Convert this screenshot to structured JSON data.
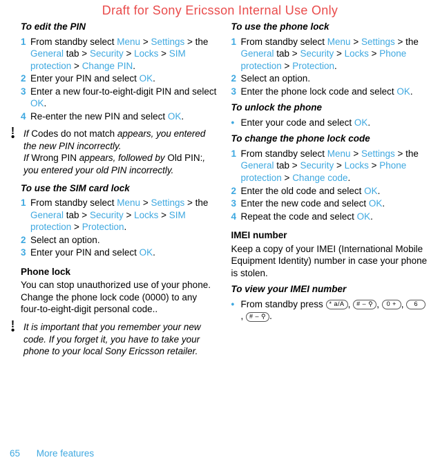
{
  "watermark": "Draft for Sony Ericsson Internal Use Only",
  "left": {
    "h_edit_pin": "To edit the PIN",
    "edit_pin_s1_a": "From standby select ",
    "menu": "Menu",
    "settings": "Settings",
    "the": " the ",
    "general": "General",
    "tab": " tab > ",
    "security": "Security",
    "locks": "Locks",
    "sim_protection": "SIM protection",
    "change_pin": "Change PIN",
    "edit_pin_s2_a": "Enter your PIN and select ",
    "ok": "OK",
    "edit_pin_s3": "Enter a new four-to-eight-digit PIN and select ",
    "edit_pin_s4": "Re-enter the new PIN and select ",
    "note1_a": "If ",
    "note1_b": "Codes do not match",
    "note1_c": " appears, you entered the new PIN incorrectly.",
    "note1_d": "If ",
    "note1_e": "Wrong PIN",
    "note1_f": " appears, followed by ",
    "note1_g": "Old PIN:",
    "note1_h": ", you entered your old PIN incorrectly.",
    "h_sim_lock": "To use the SIM card lock",
    "sim_s1_a": "From standby select ",
    "the_word": "the ",
    "protection": "Protection",
    "sim_s2": "Select an option.",
    "sim_s3": "Enter your PIN and select ",
    "h_phone_lock": "Phone lock",
    "phone_lock_para": "You can stop unauthorized use of your phone. Change the phone lock code (0000) to any four-to-eight-digit personal code..",
    "note2": "It is important that you remember your new code. If you forget it, you have to take your phone to your local Sony Ericsson retailer."
  },
  "right": {
    "h_use_phone_lock": "To use the phone lock",
    "upl_s1_a": "From standby select ",
    "phone_protection": "Phone protection",
    "upl_s2": "Select an option.",
    "upl_s3": "Enter the phone lock code and select ",
    "h_unlock": "To unlock the phone",
    "unlock_b1": "Enter your code and select ",
    "h_change_code": "To change the phone lock code",
    "cc_s1_a": "From standby select ",
    "change_code": "Change code",
    "cc_s2": "Enter the old code and select ",
    "cc_s3": "Enter the new code and select ",
    "cc_s4": "Repeat the code and select ",
    "h_imei": "IMEI number",
    "imei_para": "Keep a copy of your IMEI (International Mobile Equipment Identity) number in case your phone is stolen.",
    "h_view_imei": "To view your IMEI number",
    "imei_b1": "From standby press ",
    "k_star": "* a/A",
    "k_hash": "# ‒ ⚲",
    "k_zero": "0 +",
    "k_six": "6"
  },
  "footer": {
    "page": "65",
    "title": "More features"
  },
  "nums": {
    "n1": "1",
    "n2": "2",
    "n3": "3",
    "n4": "4"
  },
  "sym": {
    "gt": " > ",
    "dot": ".",
    "bullet": "•",
    "comma": ", "
  }
}
